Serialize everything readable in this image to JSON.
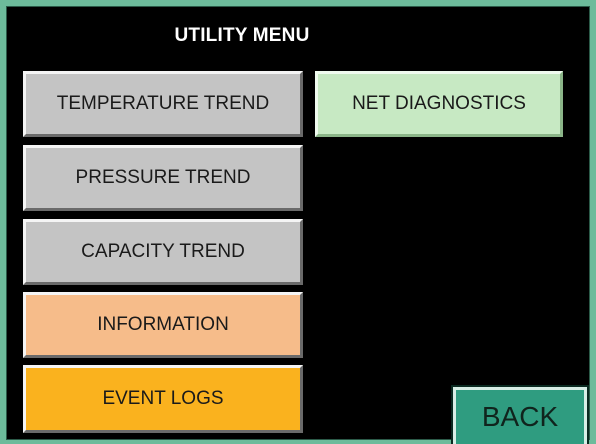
{
  "header": {
    "title": "UTILITY MENU"
  },
  "menu": {
    "temperature_trend": "TEMPERATURE TREND",
    "pressure_trend": "PRESSURE TREND",
    "capacity_trend": "CAPACITY TREND",
    "information": "INFORMATION",
    "event_logs": "EVENT LOGS",
    "net_diagnostics": "NET DIAGNOSTICS",
    "back": "BACK"
  },
  "colors": {
    "frame": "#6dbb9b",
    "panel": "#000000",
    "trend_button": "#c4c4c4",
    "information_button": "#f6bc8a",
    "event_logs_button": "#fab21e",
    "net_diagnostics_button": "#c7e9c3",
    "back_button": "#2f9c80"
  }
}
